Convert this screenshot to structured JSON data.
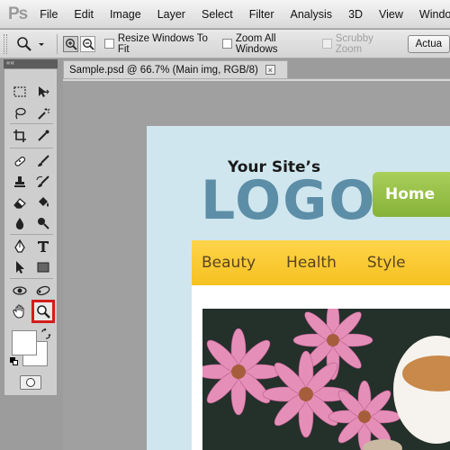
{
  "app": {
    "logo_text": "Ps"
  },
  "menu": [
    "File",
    "Edit",
    "Image",
    "Layer",
    "Select",
    "Filter",
    "Analysis",
    "3D",
    "View",
    "Window"
  ],
  "options": {
    "resize_windows_label": "Resize Windows To Fit",
    "zoom_all_label": "Zoom All Windows",
    "scrubby_zoom_label": "Scrubby Zoom",
    "actual_button_label": "Actua"
  },
  "tools_panel": {
    "collapse_glyph": "««"
  },
  "document_tab": {
    "title": "Sample.psd @ 66.7% (Main img, RGB/8)",
    "close_glyph": "×"
  },
  "canvas_doc": {
    "tagline": "Your Site’s",
    "logo": "LOGO",
    "home_button": "Home",
    "nav": [
      "Beauty",
      "Health",
      "Style"
    ]
  },
  "colors": {
    "selection_outline": "#d21c1c",
    "logo": "#5d8ea7",
    "nav_bar": "#f5c120",
    "home_button": "#8dba40"
  },
  "icons": [
    "magnifier-icon",
    "zoom-in-icon",
    "zoom-out-icon",
    "marquee-icon",
    "move-icon",
    "lasso-icon",
    "magic-wand-icon",
    "crop-icon",
    "eyedropper-icon",
    "healing-brush-icon",
    "brush-icon",
    "clone-stamp-icon",
    "history-brush-icon",
    "eraser-icon",
    "paint-bucket-icon",
    "blur-icon",
    "dodge-icon",
    "pen-icon",
    "type-icon",
    "path-selection-icon",
    "rectangle-shape-icon",
    "3d-rotate-icon",
    "3d-orbit-icon",
    "hand-icon",
    "zoom-tool-icon"
  ]
}
